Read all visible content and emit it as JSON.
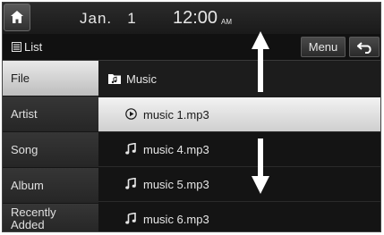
{
  "status_bar": {
    "home_icon": "home-icon",
    "date": "Jan.   1",
    "time": "12:00",
    "ampm": "AM"
  },
  "header": {
    "list_icon": "list-icon",
    "list_label": "List",
    "menu_label": "Menu",
    "back_icon": "back-arrow-icon"
  },
  "sidebar": {
    "items": [
      {
        "label": "File",
        "active": true
      },
      {
        "label": "Artist",
        "active": false
      },
      {
        "label": "Song",
        "active": false
      },
      {
        "label": "Album",
        "active": false
      },
      {
        "label": "Recently Added",
        "active": false
      }
    ]
  },
  "main": {
    "folder": {
      "icon": "folder-icon",
      "label": "Music"
    },
    "tracks": [
      {
        "label": "music 1.mp3",
        "icon": "play-icon",
        "selected": true
      },
      {
        "label": "music 4.mp3",
        "icon": "music-note-icon",
        "selected": false
      },
      {
        "label": "music 5.mp3",
        "icon": "music-note-icon",
        "selected": false
      },
      {
        "label": "music 6.mp3",
        "icon": "music-note-icon",
        "selected": false
      }
    ]
  },
  "scroll_indicators": {
    "up_icon": "scroll-up-arrow-icon",
    "down_icon": "scroll-down-arrow-icon"
  },
  "colors": {
    "background": "#1e1e1e",
    "active_item": "#e0e0e0",
    "text": "#e6e6e6"
  }
}
